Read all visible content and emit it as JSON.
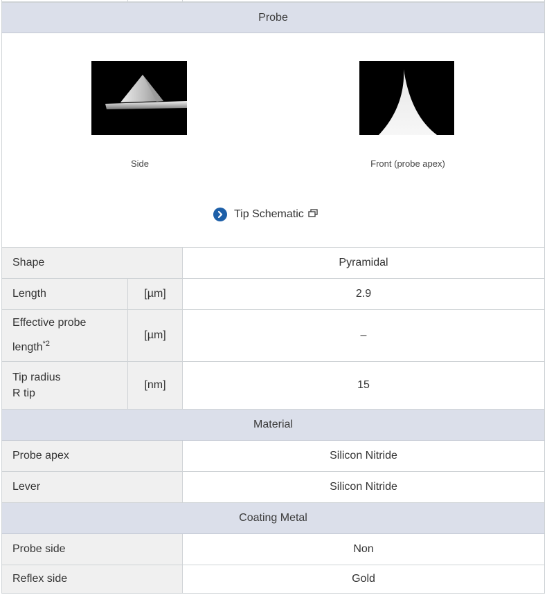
{
  "probe_section": {
    "title": "Probe",
    "side_caption": "Side",
    "front_caption": "Front (probe apex)",
    "tip_schematic_link": "Tip Schematic",
    "icons": {
      "link_arrow": "chevron-right-circle-icon",
      "new_window": "external-window-icon"
    }
  },
  "probe_specs": [
    {
      "label": "Shape",
      "unit": "",
      "value": "Pyramidal"
    },
    {
      "label": "Length",
      "unit": "[µm]",
      "value": "2.9"
    },
    {
      "label_line1": "Effective probe",
      "label_line2": "length",
      "footnote": "*2",
      "unit": "[µm]",
      "value": "–"
    },
    {
      "label_line1": "Tip radius",
      "label_line2": "R tip",
      "unit": "[nm]",
      "value": "15"
    }
  ],
  "material_section": {
    "title": "Material",
    "rows": [
      {
        "label": "Probe apex",
        "value": "Silicon Nitride"
      },
      {
        "label": "Lever",
        "value": "Silicon Nitride"
      }
    ]
  },
  "coating_section": {
    "title": "Coating Metal",
    "rows": [
      {
        "label": "Probe side",
        "value": "Non"
      },
      {
        "label": "Reflex side",
        "value": "Gold"
      }
    ]
  },
  "colors": {
    "header_bg": "#dbdfea",
    "label_bg": "#f0f0f0",
    "link_icon": "#1d5fa8",
    "border": "#cfd3d6"
  }
}
